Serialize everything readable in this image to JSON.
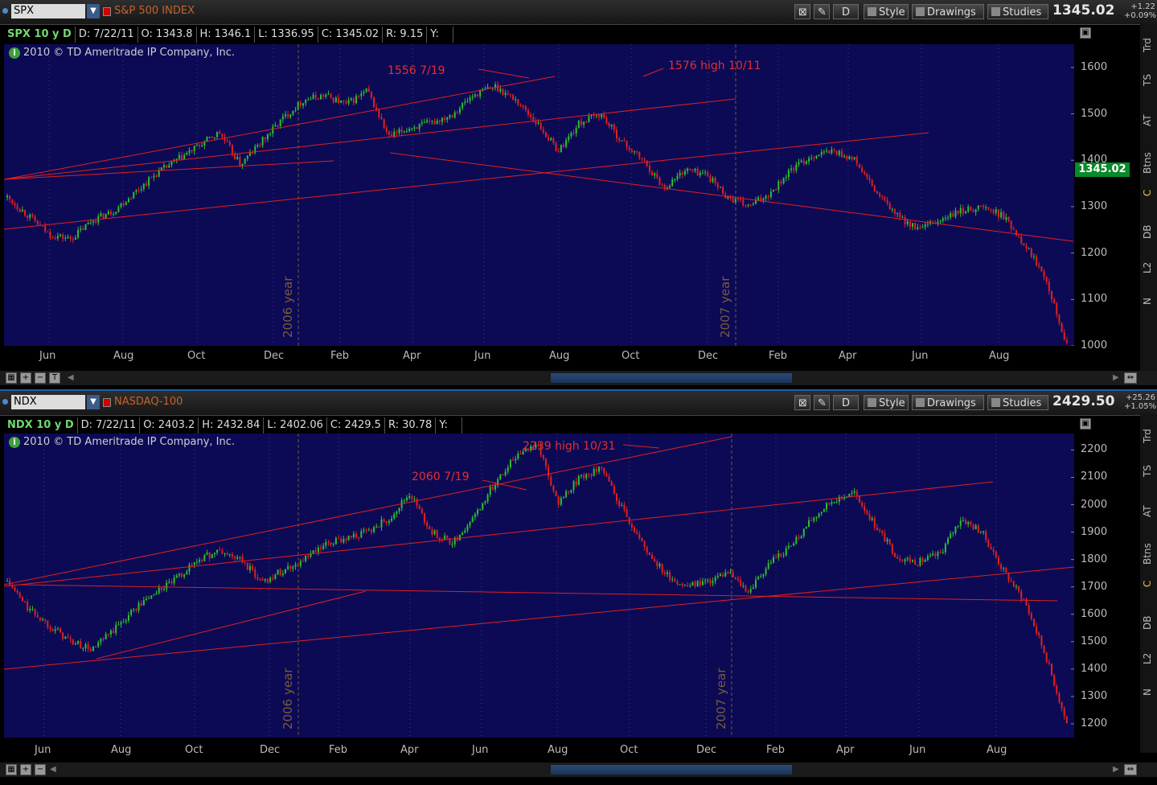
{
  "panels": [
    {
      "symbol": "SPX",
      "description": "S&P 500 INDEX",
      "price": "1345.02",
      "change": "+1.22",
      "change_pct": "+0.09%",
      "tools": {
        "style": "Style",
        "drawings": "Drawings",
        "studies": "Studies",
        "period_button": "D"
      },
      "info": {
        "series": "SPX 10 y D",
        "date": "D: 7/22/11",
        "open": "O: 1343.8",
        "high": "H: 1346.1",
        "low": "L: 1336.95",
        "close": "C: 1345.02",
        "range": "R: 9.15",
        "y": "Y:"
      },
      "copyright": "2010 © TD Ameritrade IP Company, Inc.",
      "price_tag": "1345.02",
      "annotations": [
        "1556  7/19",
        "1576  high 10/11"
      ],
      "year_labels": [
        "2006 year",
        "2007 year"
      ],
      "y_ticks": [
        "1600",
        "1500",
        "1400",
        "1300",
        "1200",
        "1100",
        "1000"
      ],
      "x_ticks": [
        "Jun",
        "Aug",
        "Oct",
        "Dec",
        "Feb",
        "Apr",
        "Jun",
        "Aug",
        "Oct",
        "Dec",
        "Feb",
        "Apr",
        "Jun",
        "Aug"
      ]
    },
    {
      "symbol": "NDX",
      "description": "NASDAQ-100",
      "price": "2429.50",
      "change": "+25.26",
      "change_pct": "+1.05%",
      "tools": {
        "style": "Style",
        "drawings": "Drawings",
        "studies": "Studies",
        "period_button": "D"
      },
      "info": {
        "series": "NDX 10 y D",
        "date": "D: 7/22/11",
        "open": "O: 2403.2",
        "high": "H: 2432.84",
        "low": "L: 2402.06",
        "close": "C: 2429.5",
        "range": "R: 30.78",
        "y": "Y:"
      },
      "copyright": "2010 © TD Ameritrade IP Company, Inc.",
      "annotations": [
        "2239 high 10/31",
        "2060  7/19"
      ],
      "year_labels": [
        "2006 year",
        "2007 year"
      ],
      "y_ticks": [
        "2200",
        "2100",
        "2000",
        "1900",
        "1800",
        "1700",
        "1600",
        "1500",
        "1400",
        "1300",
        "1200"
      ],
      "x_ticks": [
        "Jun",
        "Aug",
        "Oct",
        "Dec",
        "Feb",
        "Apr",
        "Jun",
        "Aug",
        "Oct",
        "Dec",
        "Feb",
        "Apr",
        "Jun",
        "Aug"
      ]
    }
  ],
  "sidebar": [
    "Trd",
    "TS",
    "AT",
    "Btns",
    "C",
    "DB",
    "L2",
    "N"
  ],
  "chart_data": [
    {
      "type": "candlestick",
      "title": "S&P 500 INDEX",
      "ylim": [
        1000,
        1650
      ],
      "series": [
        {
          "name": "SPX",
          "values": [
            1320,
            1280,
            1240,
            1230,
            1270,
            1290,
            1330,
            1370,
            1400,
            1430,
            1460,
            1390,
            1440,
            1490,
            1530,
            1540,
            1520,
            1550,
            1450,
            1470,
            1480,
            1500,
            1540,
            1560,
            1530,
            1480,
            1420,
            1480,
            1500,
            1440,
            1400,
            1340,
            1380,
            1370,
            1320,
            1300,
            1330,
            1380,
            1410,
            1420,
            1400,
            1330,
            1280,
            1250,
            1270,
            1290,
            1300,
            1280,
            1220,
            1150,
            1000
          ]
        }
      ],
      "annotations": [
        "1556  7/19",
        "1576  high 10/11"
      ]
    },
    {
      "type": "candlestick",
      "title": "NASDAQ-100",
      "ylim": [
        1150,
        2260
      ],
      "series": [
        {
          "name": "NDX",
          "values": [
            1720,
            1620,
            1560,
            1500,
            1470,
            1540,
            1620,
            1680,
            1730,
            1800,
            1830,
            1800,
            1720,
            1760,
            1800,
            1850,
            1880,
            1900,
            1950,
            2040,
            1900,
            1860,
            1950,
            2080,
            2180,
            2230,
            2000,
            2100,
            2130,
            1990,
            1850,
            1750,
            1700,
            1720,
            1750,
            1680,
            1790,
            1850,
            1950,
            2020,
            2040,
            1920,
            1810,
            1790,
            1820,
            1950,
            1900,
            1760,
            1650,
            1450,
            1200
          ]
        }
      ],
      "annotations": [
        "2239 high 10/31",
        "2060  7/19"
      ]
    }
  ]
}
